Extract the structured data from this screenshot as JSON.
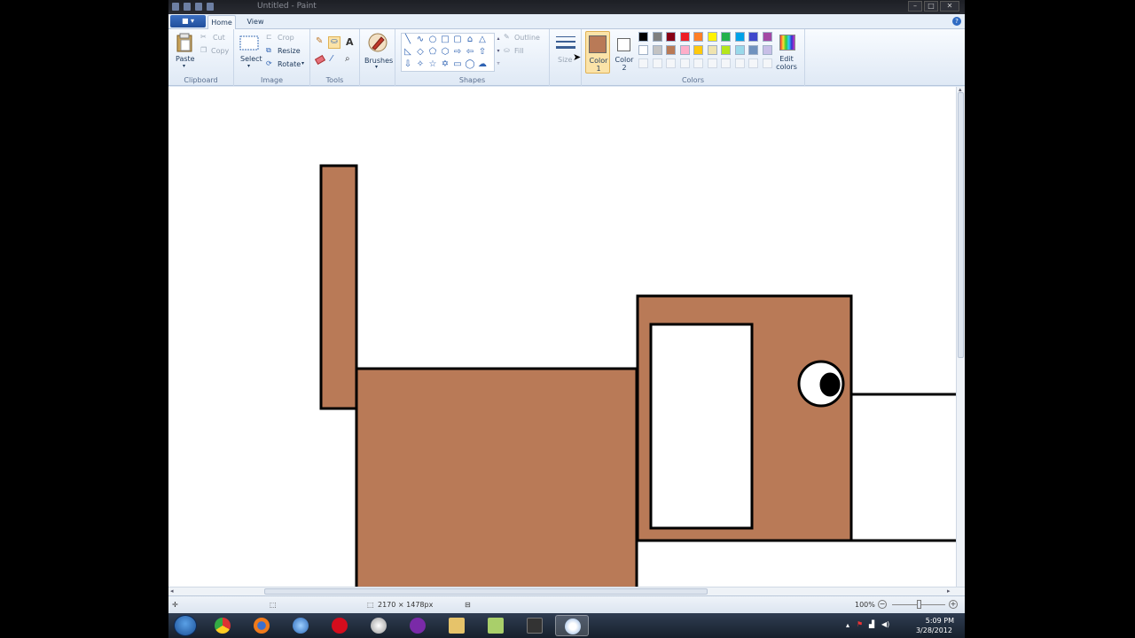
{
  "window": {
    "title": "Untitled - Paint",
    "app_menu": "■ ▾"
  },
  "tabs": {
    "home": "Home",
    "view": "View"
  },
  "clipboard": {
    "paste": "Paste",
    "cut": "Cut",
    "copy": "Copy",
    "group": "Clipboard"
  },
  "image": {
    "select": "Select",
    "crop": "Crop",
    "resize": "Resize",
    "rotate": "Rotate",
    "group": "Image"
  },
  "tools": {
    "group": "Tools"
  },
  "brushes": {
    "label": "Brushes"
  },
  "shapes": {
    "outline": "Outline",
    "fill": "Fill",
    "group": "Shapes"
  },
  "size": {
    "label": "Size"
  },
  "colors": {
    "color1": "Color 1",
    "color2": "Color 2",
    "edit": "Edit colors",
    "group": "Colors",
    "color1_value": "#b97a57",
    "color2_value": "#ffffff",
    "palette_row1": [
      "#000000",
      "#7f7f7f",
      "#880015",
      "#ed1c24",
      "#ff7f27",
      "#fff200",
      "#22b14c",
      "#00a2e8",
      "#3f48cc",
      "#a349a4"
    ],
    "palette_row2": [
      "#ffffff",
      "#c3c3c3",
      "#b97a57",
      "#ffaec9",
      "#ffc90e",
      "#efe4b0",
      "#b5e61d",
      "#99d9ea",
      "#7092be",
      "#c8bfe7"
    ]
  },
  "drawing": {
    "fill_color": "#b97a57",
    "outline_color": "#000000"
  },
  "status": {
    "image_size": "2170 × 1478px",
    "zoom": "100%"
  },
  "taskbar": {
    "time": "5:09 PM",
    "date": "3/28/2012"
  }
}
